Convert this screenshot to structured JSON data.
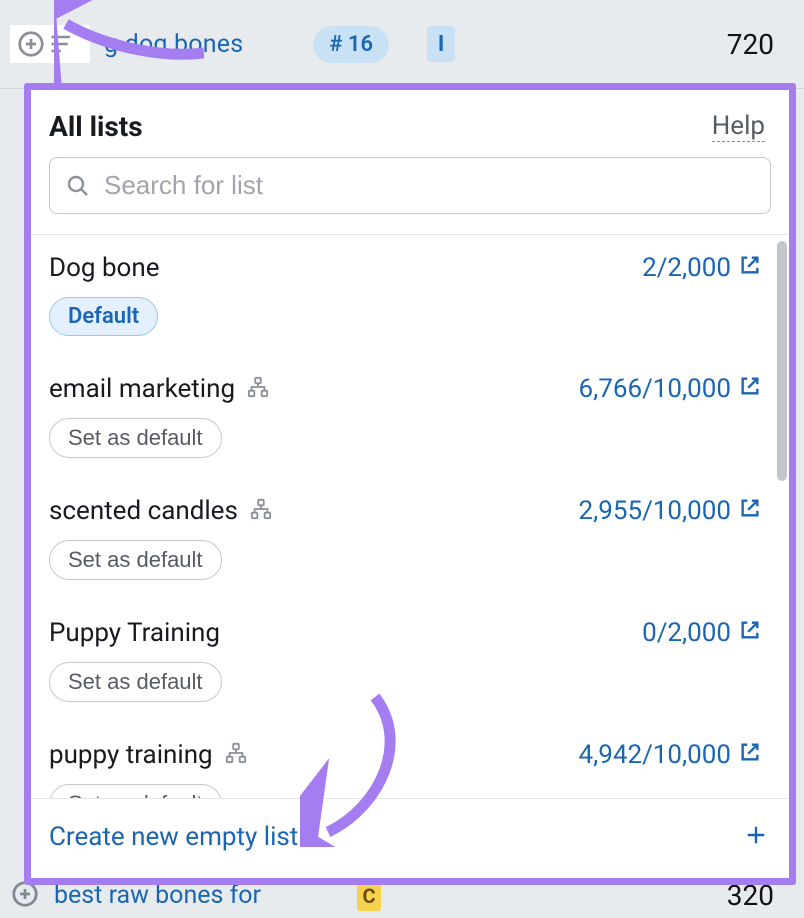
{
  "background": {
    "top_row": {
      "keyword_partial": "g dog bones",
      "rank_badge": "# 16",
      "intent_badge": "I",
      "volume": "720"
    },
    "bottom_row": {
      "keyword": "best raw bones for",
      "badge_letter": "C",
      "volume": "320"
    }
  },
  "popup": {
    "title": "All lists",
    "help_label": "Help",
    "search_placeholder": "Search for list",
    "labels": {
      "default_badge": "Default",
      "set_default": "Set as default",
      "create_new": "Create new empty list"
    },
    "lists": [
      {
        "name": "Dog bone",
        "count": "2/2,000",
        "is_default": true,
        "has_hierarchy": false
      },
      {
        "name": "email marketing",
        "count": "6,766/10,000",
        "is_default": false,
        "has_hierarchy": true
      },
      {
        "name": "scented candles",
        "count": "2,955/10,000",
        "is_default": false,
        "has_hierarchy": true
      },
      {
        "name": "Puppy Training",
        "count": "0/2,000",
        "is_default": false,
        "has_hierarchy": false
      },
      {
        "name": "puppy training",
        "count": "4,942/10,000",
        "is_default": false,
        "has_hierarchy": true
      }
    ]
  }
}
